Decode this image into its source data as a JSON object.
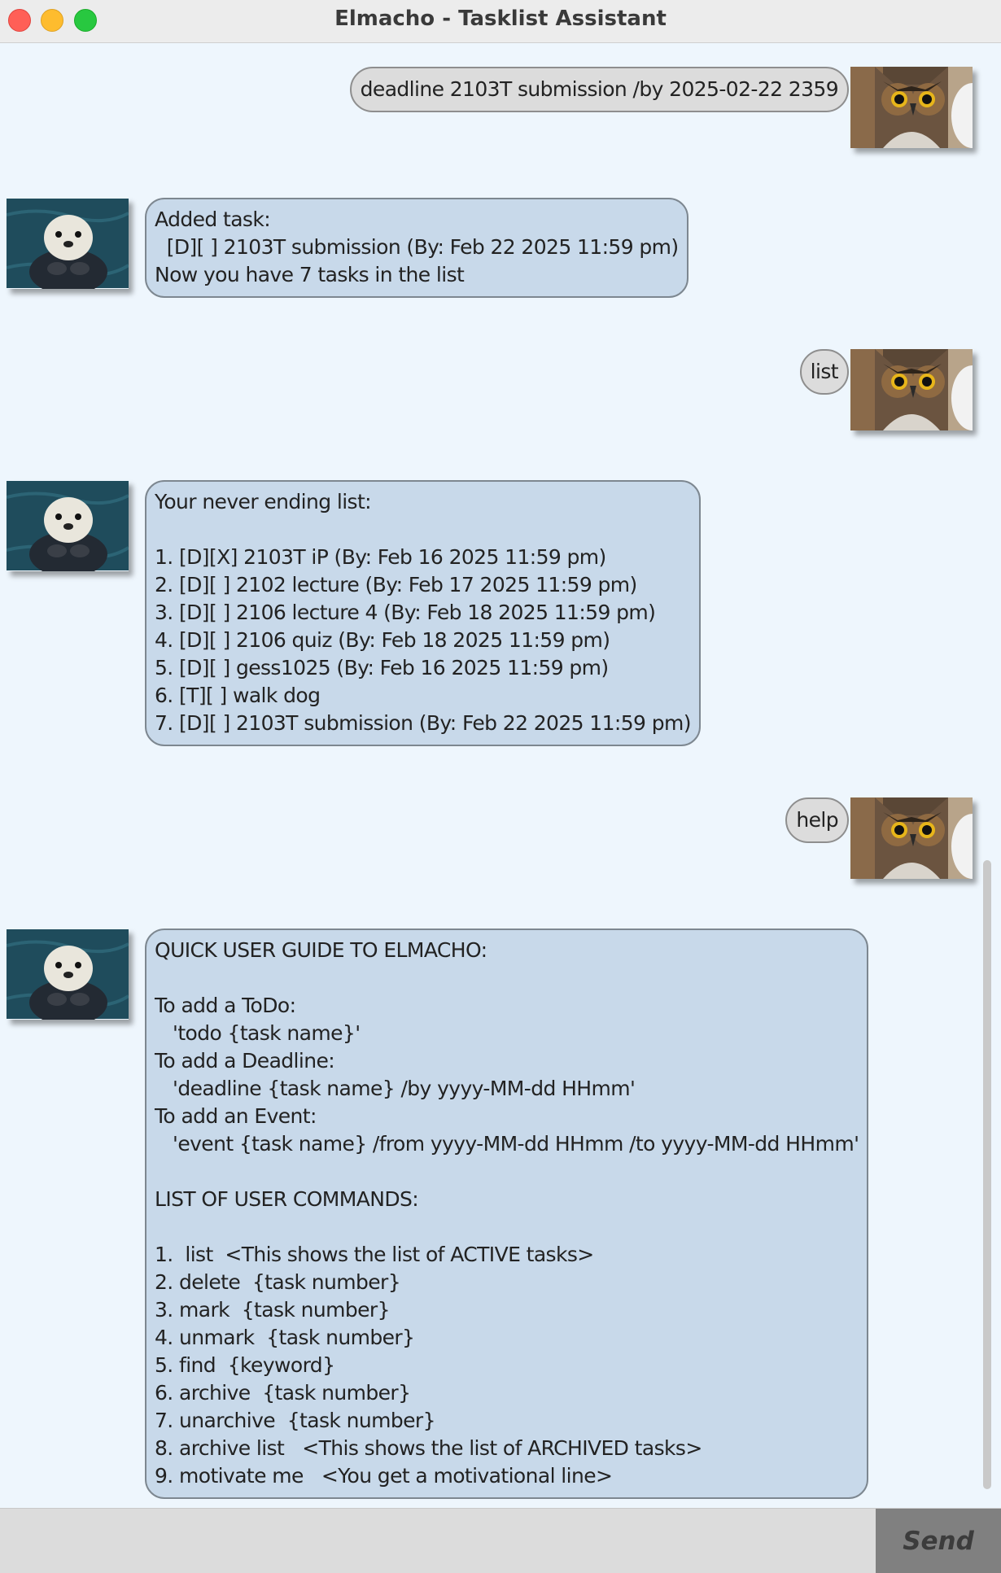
{
  "window": {
    "title": "Elmacho - Tasklist Assistant"
  },
  "messages": [
    {
      "from": "user",
      "text": "deadline 2103T submission /by 2025-02-22 2359"
    },
    {
      "from": "bot",
      "text": "Added task:\n  [D][ ] 2103T submission (By: Feb 22 2025 11:59 pm)\nNow you have 7 tasks in the list"
    },
    {
      "from": "user",
      "text": "list"
    },
    {
      "from": "bot",
      "text": "Your never ending list:\n\n1. [D][X] 2103T iP (By: Feb 16 2025 11:59 pm)\n2. [D][ ] 2102 lecture (By: Feb 17 2025 11:59 pm)\n3. [D][ ] 2106 lecture 4 (By: Feb 18 2025 11:59 pm)\n4. [D][ ] 2106 quiz (By: Feb 18 2025 11:59 pm)\n5. [D][ ] gess1025 (By: Feb 16 2025 11:59 pm)\n6. [T][ ] walk dog\n7. [D][ ] 2103T submission (By: Feb 22 2025 11:59 pm)"
    },
    {
      "from": "user",
      "text": "help"
    },
    {
      "from": "bot",
      "text": "QUICK USER GUIDE TO ELMACHO:\n\nTo add a ToDo:\n   'todo {task name}'\nTo add a Deadline:\n   'deadline {task name} /by yyyy-MM-dd HHmm'\nTo add an Event:\n   'event {task name} /from yyyy-MM-dd HHmm /to yyyy-MM-dd HHmm'\n\nLIST OF USER COMMANDS:\n\n1.  list  <This shows the list of ACTIVE tasks>\n2. delete  {task number}\n3. mark  {task number}\n4. unmark  {task number}\n5. find  {keyword}\n6. archive  {task number}\n7. unarchive  {task number}\n8. archive list   <This shows the list of ARCHIVED tasks>\n9. motivate me   <You get a motivational line>"
    }
  ],
  "input": {
    "value": ""
  },
  "send_label": "Send"
}
